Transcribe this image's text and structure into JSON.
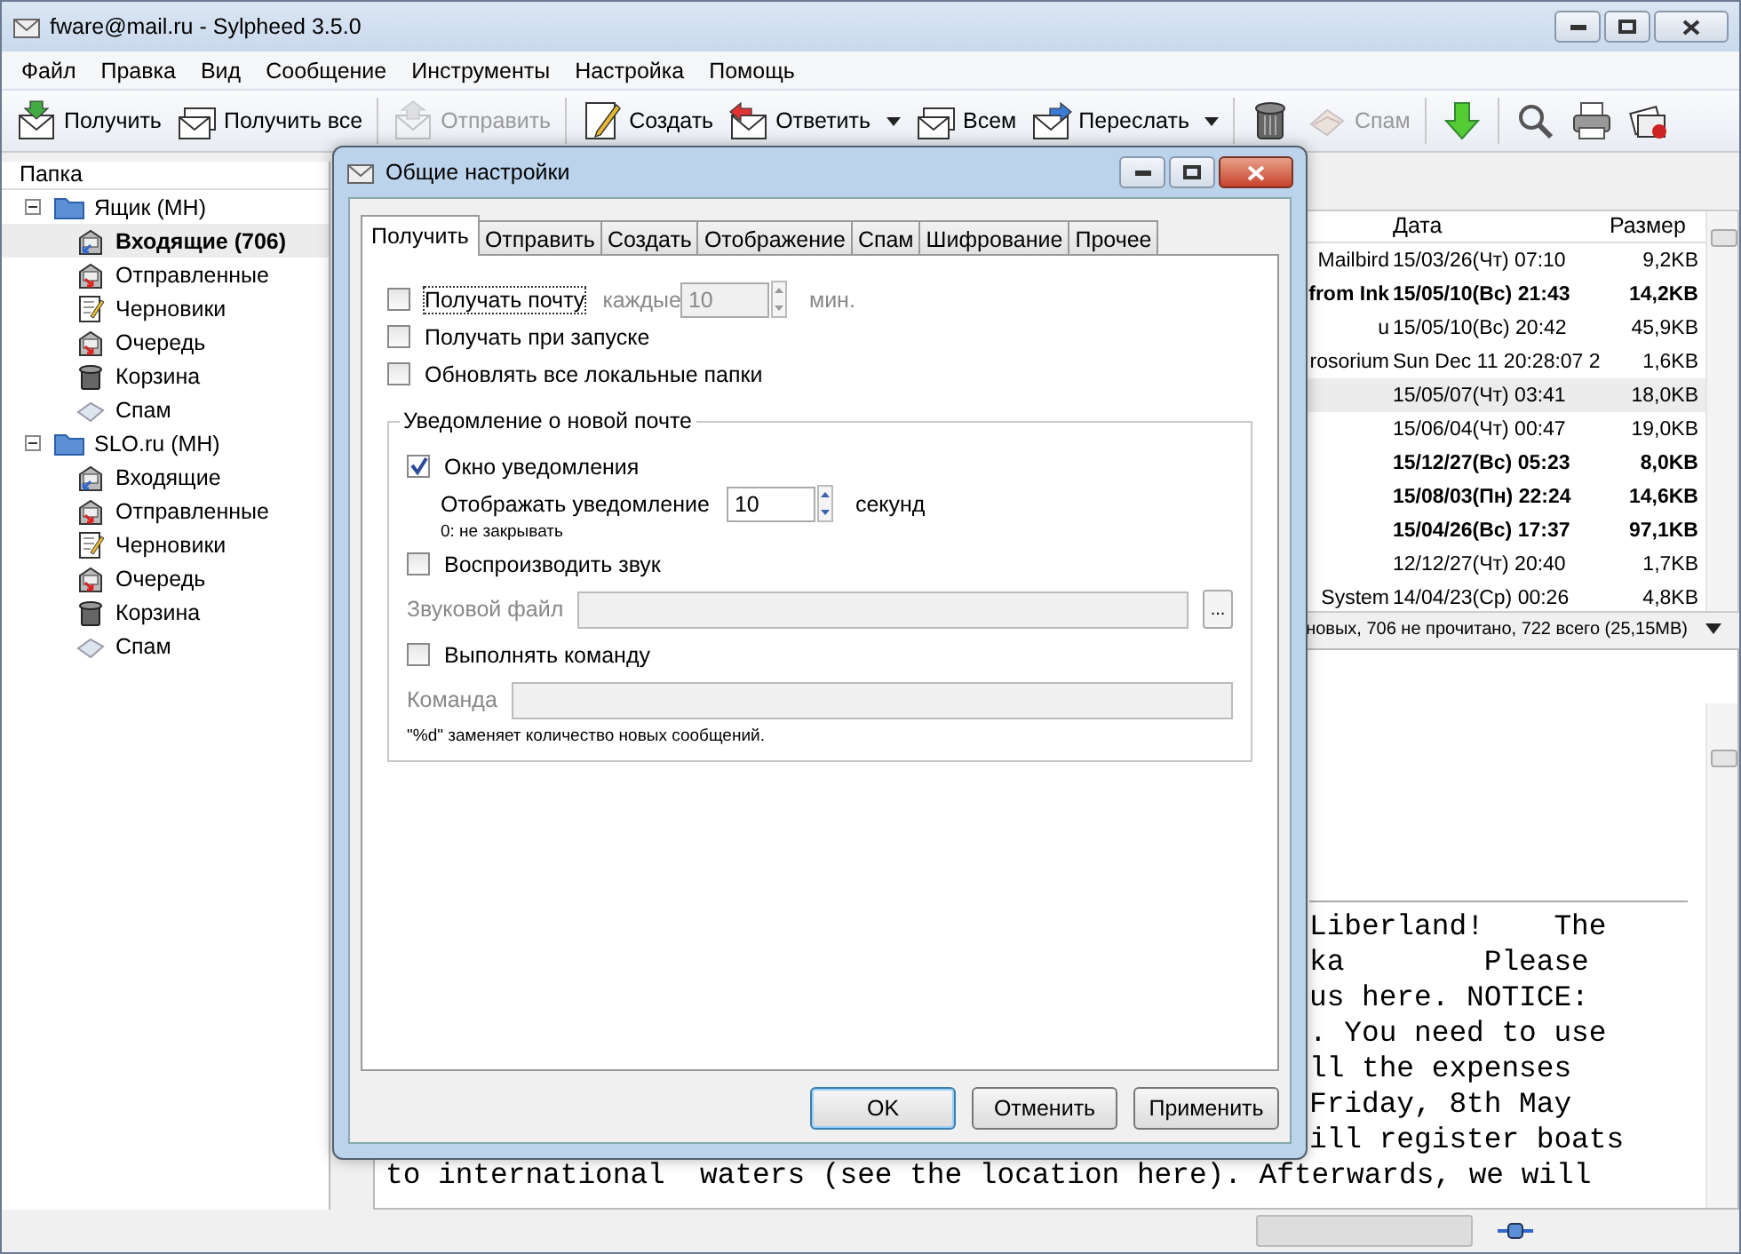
{
  "window": {
    "title": "fware@mail.ru - Sylpheed 3.5.0"
  },
  "menu": [
    "Файл",
    "Правка",
    "Вид",
    "Сообщение",
    "Инструменты",
    "Настройка",
    "Помощь"
  ],
  "toolbar": [
    {
      "kind": "receive",
      "label": "Получить",
      "disabled": false,
      "dropdown": false
    },
    {
      "kind": "receive-all",
      "label": "Получить все",
      "disabled": false,
      "dropdown": false
    },
    {
      "kind": "separator"
    },
    {
      "kind": "send",
      "label": "Отправить",
      "disabled": true,
      "dropdown": false
    },
    {
      "kind": "separator"
    },
    {
      "kind": "compose",
      "label": "Создать",
      "disabled": false,
      "dropdown": false
    },
    {
      "kind": "reply",
      "label": "Ответить",
      "disabled": false,
      "dropdown": true
    },
    {
      "kind": "reply-all",
      "label": "Всем",
      "disabled": false,
      "dropdown": false
    },
    {
      "kind": "forward",
      "label": "Переслать",
      "disabled": false,
      "dropdown": true
    },
    {
      "kind": "separator"
    },
    {
      "kind": "trash",
      "disabled": false,
      "dropdown": false
    },
    {
      "kind": "spam",
      "label": "Спам",
      "disabled": true,
      "dropdown": false
    },
    {
      "kind": "separator"
    },
    {
      "kind": "next",
      "disabled": false,
      "dropdown": false
    },
    {
      "kind": "separator"
    },
    {
      "kind": "search",
      "disabled": false,
      "dropdown": false
    },
    {
      "kind": "print",
      "disabled": false,
      "dropdown": false
    },
    {
      "kind": "stop",
      "disabled": false,
      "dropdown": false
    }
  ],
  "folder_pane": {
    "header": "Папка",
    "accounts": [
      {
        "label": "Ящик (MH)",
        "expanded": true,
        "children": [
          {
            "kind": "inbox",
            "label": "Входящие (706)",
            "selected": true,
            "unread": true
          },
          {
            "kind": "outbox",
            "label": "Отправленные",
            "selected": false,
            "unread": false
          },
          {
            "kind": "drafts",
            "label": "Черновики",
            "selected": false,
            "unread": false
          },
          {
            "kind": "queue",
            "label": "Очередь",
            "selected": false,
            "unread": false
          },
          {
            "kind": "trash",
            "label": "Корзина",
            "selected": false,
            "unread": false
          },
          {
            "kind": "spam",
            "label": "Спам",
            "selected": false,
            "unread": false
          }
        ]
      },
      {
        "label": "SLO.ru (MH)",
        "expanded": true,
        "children": [
          {
            "kind": "inbox",
            "label": "Входящие",
            "selected": false,
            "unread": false
          },
          {
            "kind": "outbox",
            "label": "Отправленные",
            "selected": false,
            "unread": false
          },
          {
            "kind": "drafts",
            "label": "Черновики",
            "selected": false,
            "unread": false
          },
          {
            "kind": "queue",
            "label": "Очередь",
            "selected": false,
            "unread": false
          },
          {
            "kind": "trash",
            "label": "Корзина",
            "selected": false,
            "unread": false
          },
          {
            "kind": "spam",
            "label": "Спам",
            "selected": false,
            "unread": false
          }
        ]
      }
    ]
  },
  "message_list": {
    "columns": [
      "Дата",
      "Размер"
    ],
    "rows": [
      {
        "column_1": "Mailbird",
        "date": "15/03/26(Чт) 07:10",
        "size": "9,2KB",
        "unread": false,
        "selected": false
      },
      {
        "column_1": "from Ink",
        "date": "15/05/10(Вс) 21:43",
        "size": "14,2KB",
        "unread": true,
        "selected": false
      },
      {
        "column_1": "u",
        "date": "15/05/10(Вс) 20:42",
        "size": "45,9KB",
        "unread": false,
        "selected": false
      },
      {
        "column_1": "rosorium",
        "date": "Sun Dec 11 20:28:07 2",
        "size": "1,6KB",
        "unread": false,
        "selected": false
      },
      {
        "date": "15/05/07(Чт) 03:41",
        "size": "18,0KB",
        "unread": false,
        "selected": true
      },
      {
        "date": "15/06/04(Чт) 00:47",
        "size": "19,0KB",
        "unread": false,
        "selected": false
      },
      {
        "date": "15/12/27(Вс) 05:23",
        "size": "8,0KB",
        "unread": true,
        "selected": false
      },
      {
        "date": "15/08/03(Пн) 22:24",
        "size": "14,6KB",
        "unread": true,
        "selected": false
      },
      {
        "date": "15/04/26(Вс) 17:37",
        "size": "97,1KB",
        "unread": true,
        "selected": false
      },
      {
        "date": "12/12/27(Чт) 20:40",
        "size": "1,7KB",
        "unread": false,
        "selected": false
      },
      {
        "column_1": "System",
        "date": "14/04/23(Ср) 00:26",
        "size": "4,8KB",
        "unread": false,
        "selected": false
      }
    ],
    "status": "новых, 706 не прочитано, 722 всего (25,15MB)"
  },
  "message_body": {
    "lines": [
      "Liberland!    The",
      "ka        Please",
      "us here. NOTICE:",
      ". You need to use",
      "ll the expenses",
      "Friday, 8th May",
      "ill register boats"
    ],
    "last_line": "to international  waters (see the location here). Afterwards, we will"
  },
  "status_bar": {
    "level": 0
  },
  "dialog": {
    "title": "Общие настройки",
    "tabs": [
      {
        "label": "Получить",
        "selected": true
      },
      {
        "label": "Отправить",
        "selected": false
      },
      {
        "label": "Создать",
        "selected": false
      },
      {
        "label": "Отображение",
        "selected": false
      },
      {
        "label": "Спам",
        "selected": false
      },
      {
        "label": "Шифрование",
        "selected": false
      },
      {
        "label": "Прочее",
        "selected": false
      }
    ],
    "check_mail": {
      "label": "Получать почту",
      "checked": false,
      "prefix": "каждые",
      "value": "10",
      "unit": "мин.",
      "disabled": true
    },
    "options": [
      {
        "label": "Получать при запуске",
        "checked": false
      },
      {
        "label": "Обновлять все локальные папки",
        "checked": false
      }
    ],
    "notification": {
      "title": "Уведомление о новой почте",
      "popup": {
        "label": "Окно уведомления",
        "checked": true
      },
      "duration": {
        "label": "Отображать уведомление",
        "value": "10",
        "unit": "секунд",
        "hint": "0: не закрывать"
      },
      "sound": {
        "label": "Воспроизводить звук",
        "checked": false
      },
      "sound_file": {
        "label": "Звуковой файл",
        "disabled": true,
        "browse": "..."
      },
      "command_toggle": {
        "label": "Выполнять команду",
        "checked": false
      },
      "command": {
        "label": "Команда",
        "disabled": true
      },
      "hint": "\"%d\" заменяет количество новых сообщений."
    },
    "buttons": [
      {
        "label": "OK",
        "default": true
      },
      {
        "label": "Отменить",
        "default": false
      },
      {
        "label": "Применить",
        "default": false
      }
    ]
  }
}
